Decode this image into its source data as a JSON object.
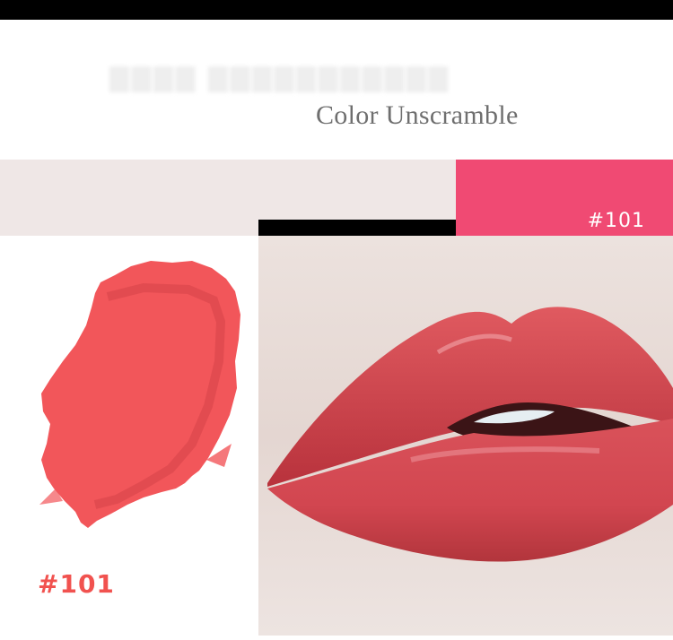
{
  "header": {
    "title": "Color Unscramble"
  },
  "shade": {
    "code": "#101",
    "swatch_color": "#f04a73",
    "smear_color": "#f2565a",
    "label_color": "#f1524f"
  },
  "photo": {
    "lip_color": "#cc3f46",
    "skin_color": "#e9ddd8"
  }
}
